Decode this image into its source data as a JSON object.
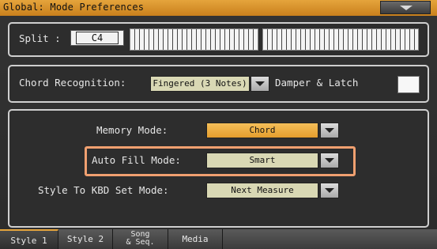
{
  "window": {
    "title": "Global: Mode Preferences"
  },
  "split": {
    "label": "Split :",
    "value": "C4"
  },
  "chord": {
    "label": "Chord Recognition:",
    "value": "Fingered (3 Notes)",
    "damper_label": "Damper & Latch"
  },
  "memory": {
    "label": "Memory Mode:",
    "value": "Chord"
  },
  "autofill": {
    "label": "Auto Fill Mode:",
    "value": "Smart"
  },
  "stylekbd": {
    "label": "Style To KBD Set Mode:",
    "value": "Next Measure"
  },
  "tabs": [
    {
      "label": "Style 1"
    },
    {
      "label": "Style 2"
    },
    {
      "label_line1": "Song",
      "label_line2": "& Seq."
    },
    {
      "label": "Media"
    }
  ],
  "colors": {
    "accent": "#e5a43c",
    "highlight": "#f0a070",
    "field": "#d9d8b4"
  }
}
